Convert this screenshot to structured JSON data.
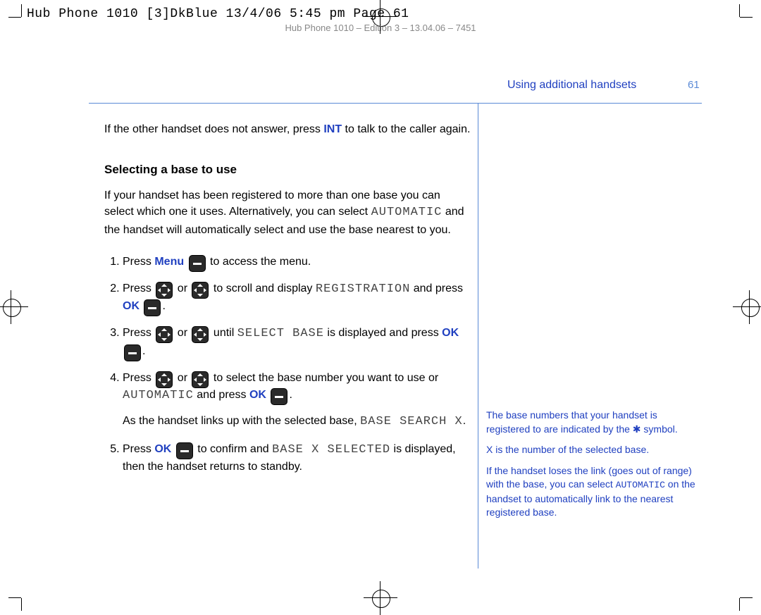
{
  "print_header": "Hub Phone 1010 [3]DkBlue  13/4/06  5:45 pm  Page 61",
  "print_subheader": "Hub Phone 1010 – Edition 3 – 13.04.06 – 7451",
  "header_title": "Using additional handsets",
  "page_number": "61",
  "intro": {
    "prefix": "If the other handset does not answer, press ",
    "key": "INT",
    "suffix": " to talk to the caller again."
  },
  "section_heading": "Selecting a base to use",
  "section_intro": {
    "p1a": "If your handset has been registered to more than one base you can select which one it uses. Alternatively, you can select ",
    "lcd1": "AUTOMATIC",
    "p1b": " and the handset will automatically select and use the base nearest to you."
  },
  "steps": {
    "s1a": "Press ",
    "s1key": "Menu",
    "s1b": " to access the menu.",
    "s2a": "Press ",
    "s2or": " or ",
    "s2b": " to scroll and display ",
    "s2lcd": "REGISTRATION",
    "s2c": " and press ",
    "s2key": "OK",
    "s2d": ".",
    "s3a": "Press ",
    "s3or": " or ",
    "s3b": " until ",
    "s3lcd": "SELECT BASE",
    "s3c": " is displayed and press ",
    "s3key": "OK",
    "s3d": ".",
    "s4a": "Press ",
    "s4or": " or ",
    "s4b": " to select the base number you want to use or ",
    "s4lcd": "AUTOMATIC",
    "s4c": " and press ",
    "s4key": "OK",
    "s4d": ".",
    "s4note_a": "As the handset links up with the selected base, ",
    "s4note_lcd": "BASE SEARCH X",
    "s4note_b": ".",
    "s5a": "Press ",
    "s5key": "OK",
    "s5b": " to confirm and ",
    "s5lcd": "BASE X SELECTED",
    "s5c": " is displayed, then the handset returns to standby."
  },
  "sidebar": {
    "p1": "The base numbers that your handset is registered to are indicated by the ✱ symbol.",
    "p2": "X is the number of the selected base.",
    "p3a": "If the handset loses the link (goes out of range) with the base, you can select ",
    "p3lcd": "AUTOMATIC",
    "p3b": " on the handset to automatically link to the nearest registered base."
  }
}
